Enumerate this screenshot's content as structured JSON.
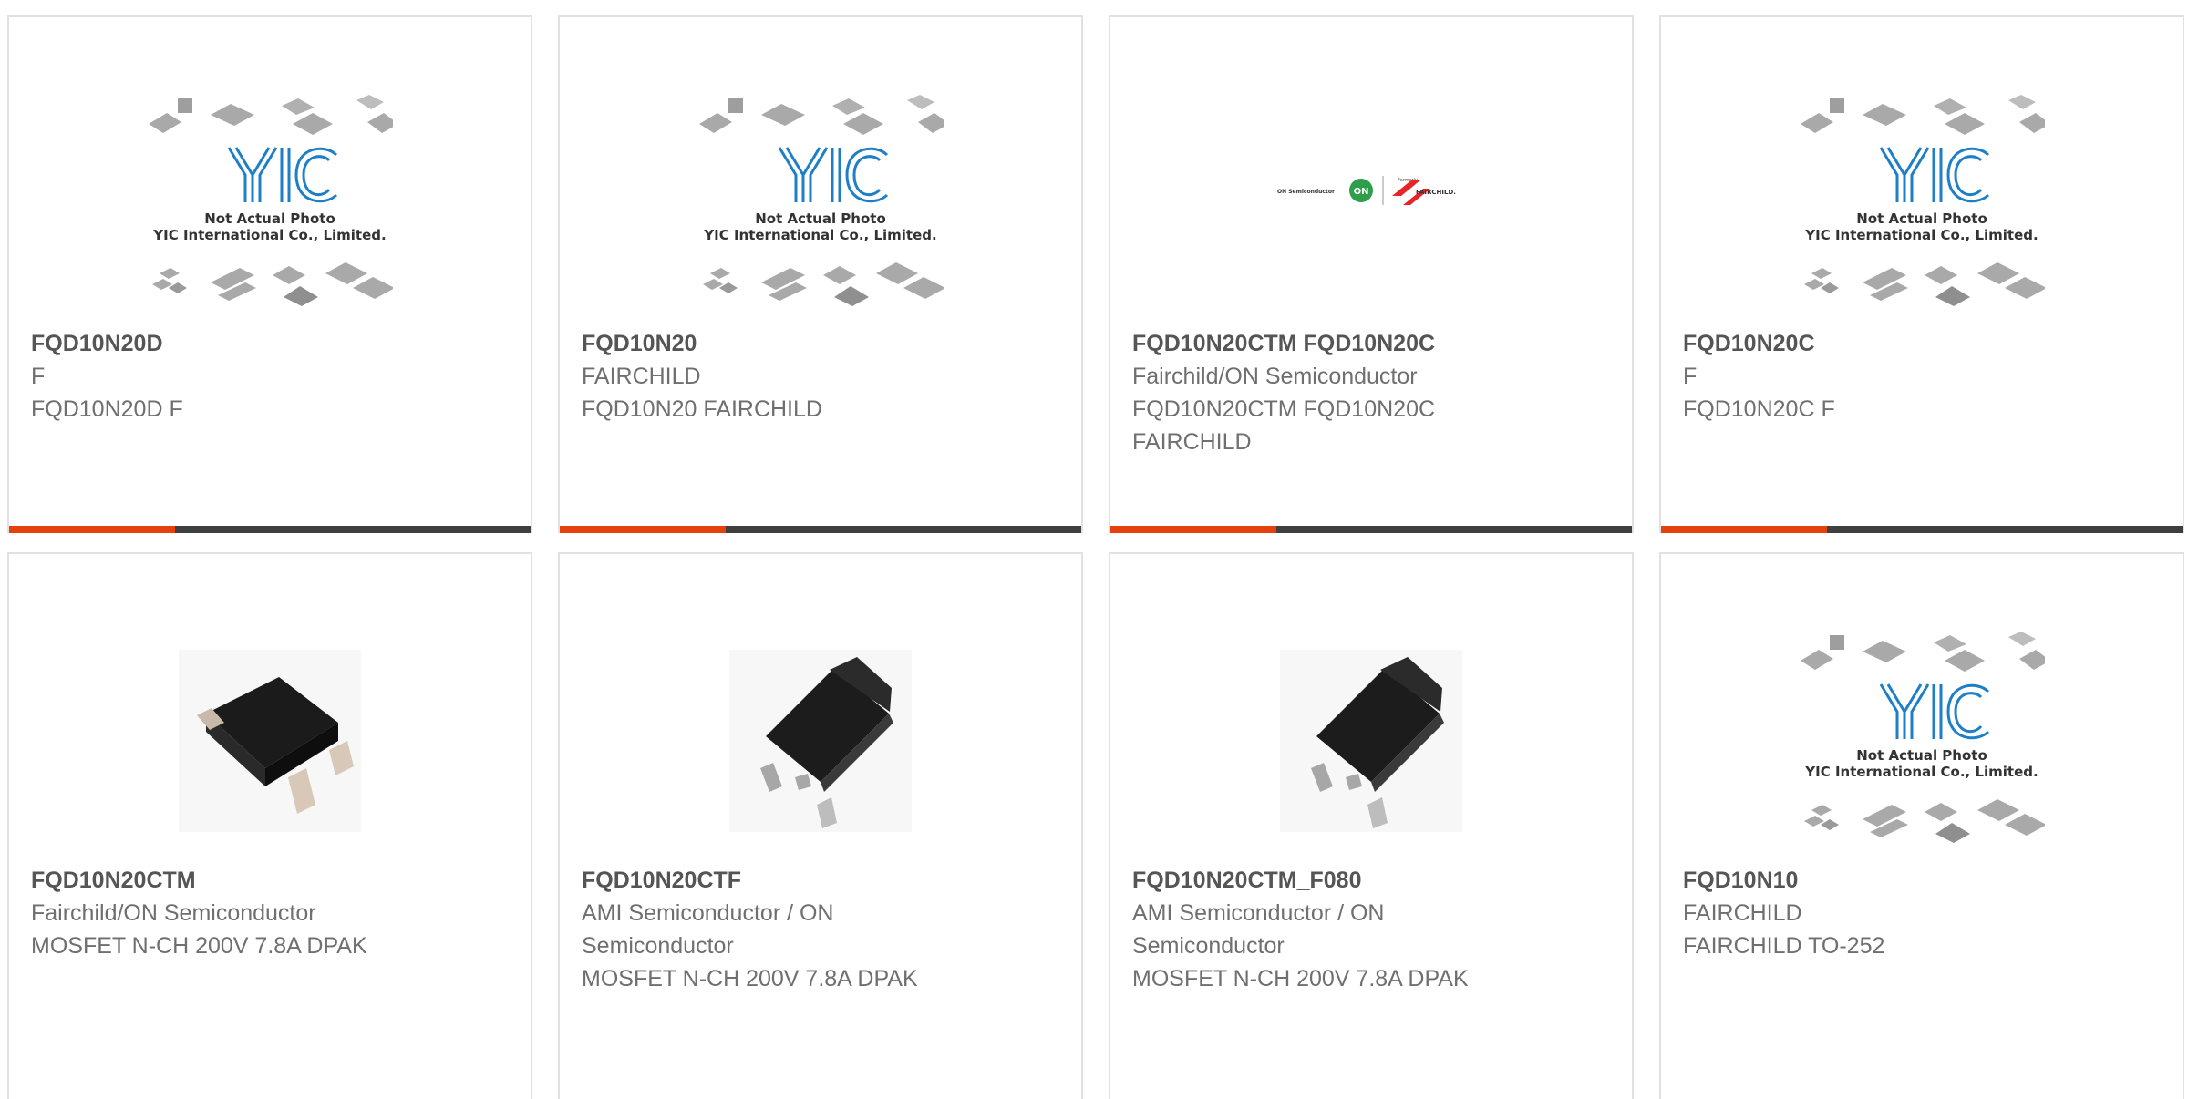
{
  "placeholder": {
    "brand": "YIC",
    "line1": "Not Actual Photo",
    "line2": "YIC International Co., Limited."
  },
  "logo": {
    "left_text": "ON Semiconductor",
    "badge": "ON",
    "small_text": "Formerly",
    "right_text": "FAIRCHILD."
  },
  "products": [
    {
      "part": "FQD10N20D",
      "maker": "F",
      "desc": [
        "FQD10N20D F"
      ],
      "image": "yic-placeholder-icon"
    },
    {
      "part": "FQD10N20",
      "maker": "FAIRCHILD",
      "desc": [
        "FQD10N20 FAIRCHILD"
      ],
      "image": "yic-placeholder-icon"
    },
    {
      "part": "FQD10N20CTM FQD10N20C",
      "maker": "Fairchild/ON Semiconductor",
      "desc": [
        "FQD10N20CTM FQD10N20C",
        "FAIRCHILD"
      ],
      "image": "on-fairchild-logo"
    },
    {
      "part": "FQD10N20C",
      "maker": "F",
      "desc": [
        "FQD10N20C F"
      ],
      "image": "yic-placeholder-icon"
    },
    {
      "part": "FQD10N20CTM",
      "maker": "Fairchild/ON Semiconductor",
      "desc": [
        "MOSFET N-CH 200V 7.8A DPAK"
      ],
      "image": "dpak-chip-photo"
    },
    {
      "part": "FQD10N20CTF",
      "maker": "AMI Semiconductor / ON Semiconductor",
      "maker_lines": [
        "AMI Semiconductor / ON",
        "Semiconductor"
      ],
      "desc": [
        "MOSFET N-CH 200V 7.8A DPAK"
      ],
      "image": "dpak-chip-photo"
    },
    {
      "part": "FQD10N20CTM_F080",
      "maker": "AMI Semiconductor / ON Semiconductor",
      "maker_lines": [
        "AMI Semiconductor / ON",
        "Semiconductor"
      ],
      "desc": [
        "MOSFET N-CH 200V 7.8A DPAK"
      ],
      "image": "dpak-chip-photo"
    },
    {
      "part": "FQD10N10",
      "maker": "FAIRCHILD",
      "desc": [
        "FAIRCHILD TO-252"
      ],
      "image": "yic-placeholder-icon"
    }
  ],
  "colors": {
    "accent": "#e5410f",
    "bar": "#3f3f3f",
    "yic_blue": "#1e7fc7"
  }
}
